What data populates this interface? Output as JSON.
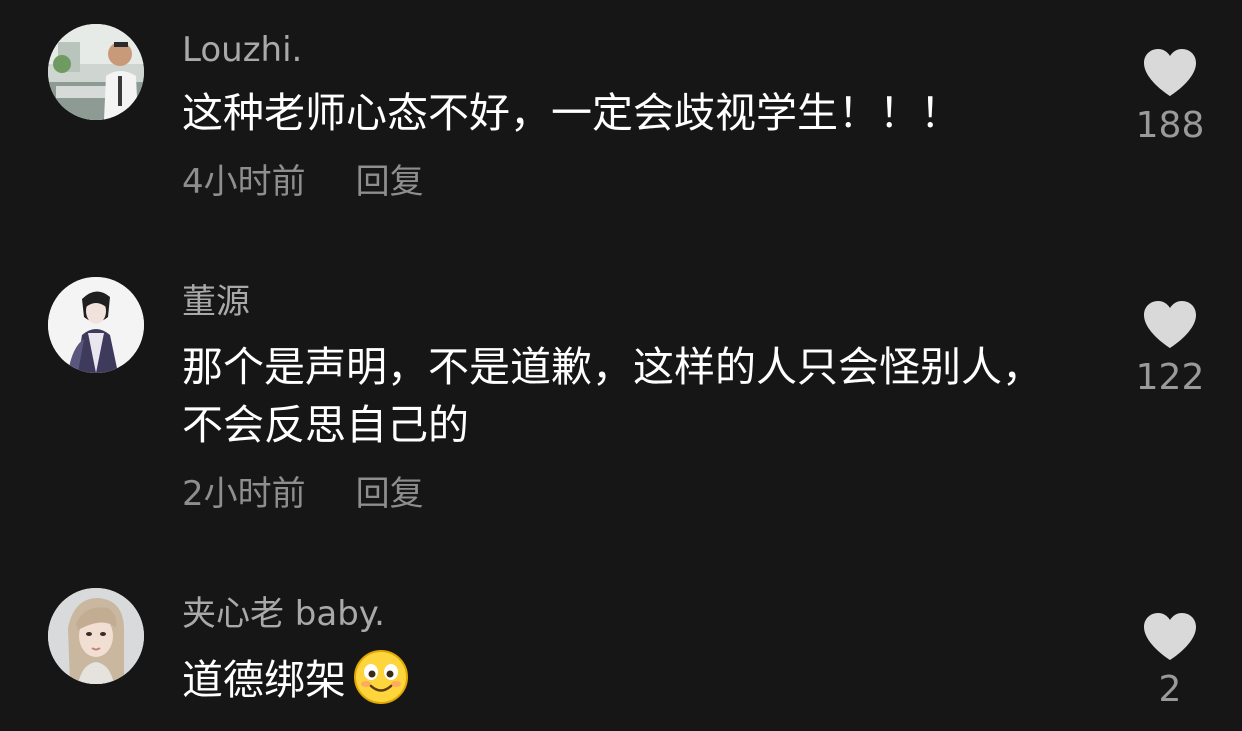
{
  "comments": [
    {
      "author": "Louzhi.",
      "text": "这种老师心态不好，一定会歧视学生！！！",
      "time": "4小时前",
      "reply": "回复",
      "likes": "188"
    },
    {
      "author": "董源",
      "text": "那个是声明，不是道歉，这样的人只会怪别人，不会反思自己的",
      "time": "2小时前",
      "reply": "回复",
      "likes": "122"
    },
    {
      "author": "夹心老 baby.",
      "text": "道德绑架",
      "emoji": "smiling-face-emoji",
      "time": "",
      "reply": "",
      "likes": "2"
    }
  ],
  "icons": {
    "like": "heart-icon"
  },
  "colors": {
    "background": "#161616",
    "author": "#a9a9a9",
    "meta": "#8e8e8e",
    "heart": "#d9d9d9"
  }
}
